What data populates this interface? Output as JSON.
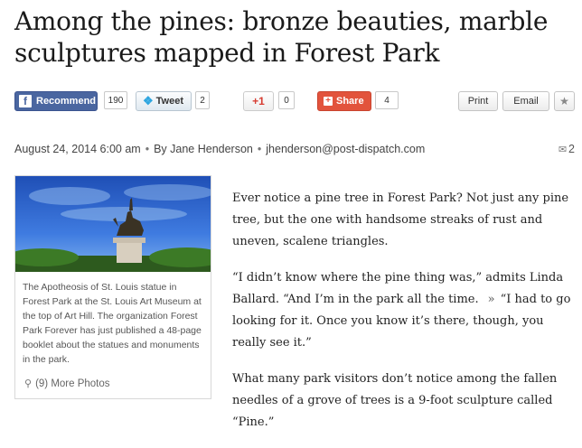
{
  "headline": "Among the pines: bronze beauties, marble sculptures mapped in Forest Park",
  "share": {
    "facebook_label": "Recommend",
    "facebook_count": "190",
    "twitter_label": "Tweet",
    "twitter_count": "2",
    "gplus_label": "+1",
    "gplus_count": "0",
    "share_label": "Share",
    "share_count": "4",
    "print_label": "Print",
    "email_label": "Email"
  },
  "meta": {
    "date": "August 24, 2014 6:00 am",
    "byline": "By Jane Henderson",
    "email": "jhenderson@post-dispatch.com",
    "comment_count": "2"
  },
  "photo": {
    "caption": "The Apotheosis of St. Louis statue in Forest Park at the St. Louis Art Museum at the top of Art Hill. The organization Forest Park Forever has just published a 48-page booklet about the statues and monuments in the park.",
    "more_photos": "(9) More Photos"
  },
  "article": {
    "p1": "Ever notice a pine tree in Forest Park? Not just any pine tree, but the one with handsome streaks of rust and uneven, scalene triangles.",
    "p2a": "“I didn’t know where the pine thing was,” admits Linda Ballard. “And I’m in the park all the time.",
    "p2b": "“I had to go looking for it. Once you know it’s there, though, you really see it.”",
    "p3": "What many park visitors don’t notice among the fallen needles of a grove of trees is a 9-foot sculpture called “Pine.”"
  },
  "colors": {
    "facebook": "#4a66a0",
    "twitter_icon": "#2ea6e0",
    "gplus": "#d73d32",
    "share": "#e2533c"
  },
  "icons": {
    "facebook": "facebook-icon",
    "twitter": "twitter-bird-icon",
    "share": "plus-icon",
    "star": "star-icon",
    "comment": "comment-bubble-icon",
    "magnifier": "magnifier-icon",
    "arrow": "double-chevron-right-icon"
  }
}
